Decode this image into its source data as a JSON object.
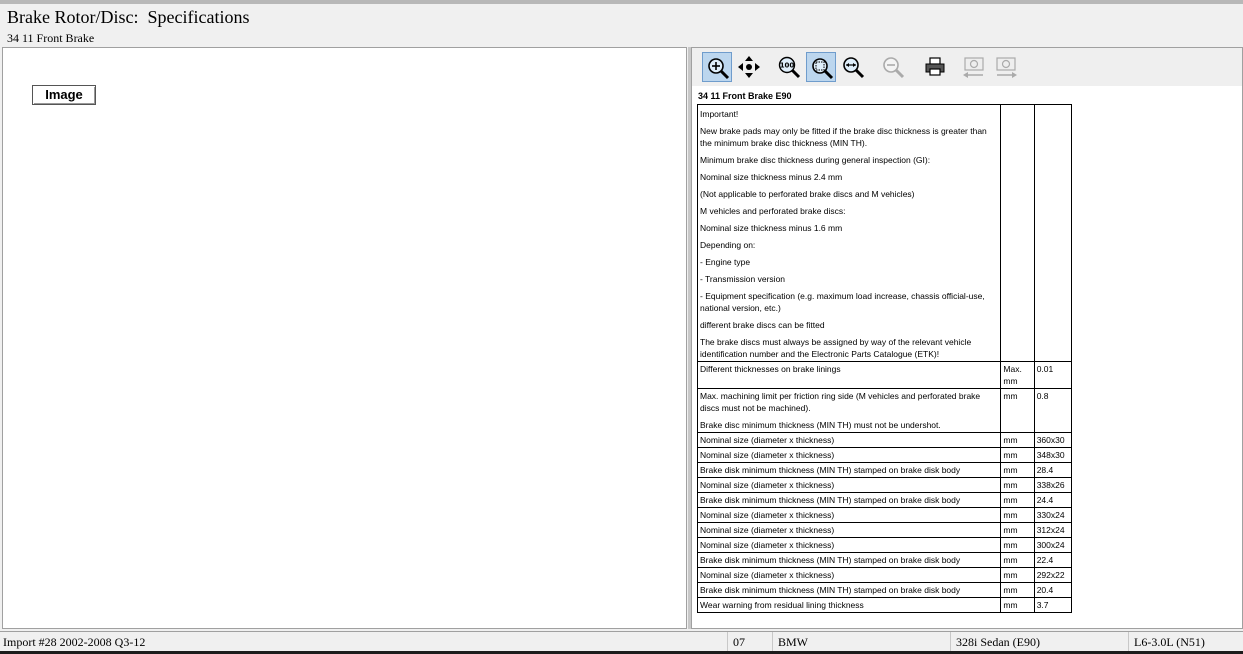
{
  "header": {
    "title": "Brake Rotor/Disc:  Specifications",
    "subtitle": "34 11 Front Brake"
  },
  "left_pane": {
    "image_button_label": "Image"
  },
  "toolbar": {
    "buttons": [
      {
        "icon": "zoom-in-icon",
        "active": true
      },
      {
        "icon": "pan-icon",
        "active": false
      },
      {
        "icon": "zoom-100-icon",
        "active": false
      },
      {
        "icon": "zoom-fit-icon",
        "active": true
      },
      {
        "icon": "zoom-width-icon",
        "active": false
      },
      {
        "icon": "zoom-out-icon",
        "active": false
      },
      {
        "icon": "print-icon",
        "active": false
      },
      {
        "icon": "previous-page-icon",
        "active": false
      },
      {
        "icon": "next-page-icon",
        "active": false
      }
    ]
  },
  "document": {
    "title": "34 11 Front Brake E90",
    "notes": [
      "Important!",
      "New brake pads may only be fitted if the brake disc thickness is greater than the minimum brake disc thickness (MIN TH).",
      "Minimum brake disc thickness during general inspection (GI):",
      "Nominal size thickness minus 2.4 mm",
      "(Not applicable to perforated brake discs and M vehicles)",
      "M vehicles and perforated brake discs:",
      "Nominal size thickness minus 1.6 mm",
      "Depending on:",
      "- Engine type",
      "- Transmission version",
      "- Equipment specification (e.g. maximum load increase, chassis official-use, national version, etc.)",
      "different brake discs can be fitted",
      "The brake discs must always be assigned by way of the relevant vehicle identification number and the Electronic Parts Catalogue (ETK)!"
    ],
    "rows": [
      {
        "desc": "Different thicknesses on brake linings",
        "unit": "Max. mm",
        "value": "0.01"
      },
      {
        "desc": "Max. machining limit per friction ring side (M vehicles and perforated brake discs must not be machined).",
        "desc2": "Brake disc minimum thickness (MIN TH) must not be undershot.",
        "unit": "mm",
        "value": "0.8"
      },
      {
        "desc": "Nominal size (diameter x thickness)",
        "unit": "mm",
        "value": "360x30"
      },
      {
        "desc": "Nominal size (diameter x thickness)",
        "unit": "mm",
        "value": "348x30"
      },
      {
        "desc": "Brake disk minimum thickness (MIN TH) stamped on brake disk body",
        "unit": "mm",
        "value": "28.4"
      },
      {
        "desc": "Nominal size (diameter x thickness)",
        "unit": "mm",
        "value": "338x26"
      },
      {
        "desc": "Brake disk minimum thickness (MIN TH) stamped on brake disk body",
        "unit": "mm",
        "value": "24.4"
      },
      {
        "desc": "Nominal size (diameter x thickness)",
        "unit": "mm",
        "value": "330x24"
      },
      {
        "desc": "Nominal size (diameter x thickness)",
        "unit": "mm",
        "value": "312x24"
      },
      {
        "desc": "Nominal size (diameter x thickness)",
        "unit": "mm",
        "value": "300x24"
      },
      {
        "desc": "Brake disk minimum thickness (MIN TH) stamped on brake disk body",
        "unit": "mm",
        "value": "22.4"
      },
      {
        "desc": "Nominal size (diameter x thickness)",
        "unit": "mm",
        "value": "292x22"
      },
      {
        "desc": "Brake disk minimum thickness (MIN TH) stamped on brake disk body",
        "unit": "mm",
        "value": "20.4"
      },
      {
        "desc": "Wear warning from residual lining thickness",
        "unit": "mm",
        "value": "3.7"
      }
    ]
  },
  "status": {
    "import": "Import #28 2002-2008 Q3-12",
    "code": "07",
    "make": "BMW",
    "model": "328i Sedan (E90)",
    "engine": "L6-3.0L (N51)"
  }
}
